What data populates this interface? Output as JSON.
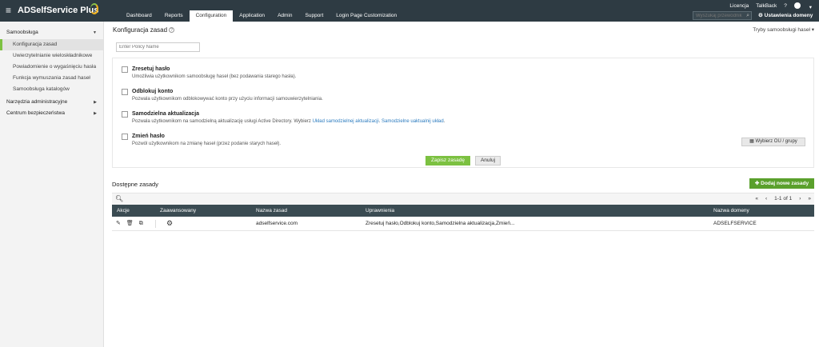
{
  "app": {
    "logo": "ADSelfService Plus"
  },
  "nav": {
    "tabs": [
      "Dashboard",
      "Reports",
      "Configuration",
      "Application",
      "Admin",
      "Support",
      "Login Page Customization"
    ],
    "active": "Configuration"
  },
  "toplinks": {
    "license": "Licencja",
    "talkback": "TalkBack",
    "help": "?"
  },
  "search": {
    "placeholder": "Wyszukaj przewodnik"
  },
  "settings_label": "Ustawienia domeny",
  "sidebar": {
    "group1": "Samoobsługa",
    "items": [
      "Konfiguracja zasad",
      "Uwierzytelnianie wieloskładnikowe",
      "Powiadomienie o wygaśnięciu hasła",
      "Funkcja wymuszania zasad haseł",
      "Samoobsługa katalogów"
    ],
    "group2": "Narzędzia administracyjne",
    "group3": "Centrum bezpieczeństwa"
  },
  "main": {
    "title": "Konfiguracja zasad",
    "modes": "Tryby samoobsługi haseł",
    "policy_placeholder": "Enter Policy Name",
    "options": [
      {
        "title": "Zresetuj hasło",
        "desc": "Umożliwia użytkownikom samoobsługę haseł (bez podawania starego hasła)."
      },
      {
        "title": "Odblokuj konto",
        "desc": "Pozwala użytkownikom odblokowywać konto przy użyciu informacji samouwierzytelniania."
      },
      {
        "title": "Samodzielna aktualizacja",
        "desc": "Pozwala użytkownikom na samodzielną aktualizację usługi Active Directory. Wybierz ",
        "link1": "Układ samodzielnej aktualizacji",
        "mid": ". ",
        "link2": "Samodzielne uaktualnij układ",
        "end": "."
      },
      {
        "title": "Zmień hasło",
        "desc": "Pozwól użytkownikom na zmianę haseł (przez podanie starych haseł)."
      }
    ],
    "pick_btn": "Wybierz OU / grupy",
    "save_btn": "Zapisz zasadę",
    "cancel_btn": "Anuluj",
    "avail_title": "Dostępne zasady",
    "add_btn": "Dodaj nowe zasady",
    "pager": {
      "first": "«",
      "prev": "‹",
      "range": "1-1 of 1",
      "next": "›",
      "last": "»"
    },
    "columns": [
      "Akcje",
      "Zaawansowany",
      "Nazwa zasad",
      "Uprawnienia",
      "Nazwa domeny"
    ],
    "rows": [
      {
        "name": "adselfservice.com",
        "perms": "Zresetuj hasło,Odblokuj konto,Samodzielna aktualizacja,Zmień...",
        "domain": "ADSELFSERVICE"
      }
    ]
  }
}
